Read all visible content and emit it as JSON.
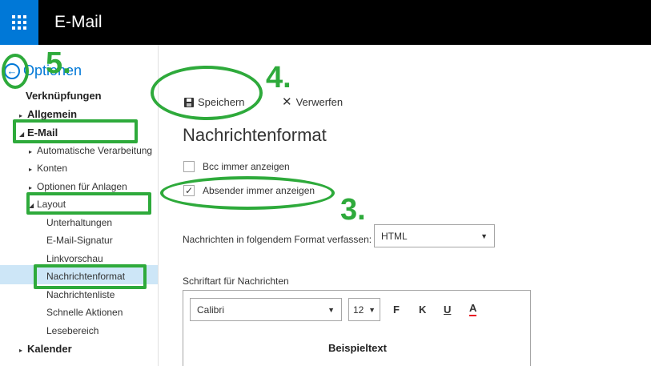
{
  "app": {
    "title": "E-Mail"
  },
  "sidebar": {
    "back_label": "Optionen",
    "items": [
      {
        "label": "Verknüpfungen"
      },
      {
        "label": "Allgemein",
        "arrow": "▸"
      },
      {
        "label": "E-Mail",
        "arrow": "◢"
      },
      {
        "label": "Automatische Verarbeitung",
        "arrow": "▸"
      },
      {
        "label": "Konten",
        "arrow": "▸"
      },
      {
        "label": "Optionen für Anlagen",
        "arrow": "▸"
      },
      {
        "label": "Layout",
        "arrow": "◢"
      },
      {
        "label": "Unterhaltungen"
      },
      {
        "label": "E-Mail-Signatur"
      },
      {
        "label": "Linkvorschau"
      },
      {
        "label": "Nachrichtenformat"
      },
      {
        "label": "Nachrichtenliste"
      },
      {
        "label": "Schnelle Aktionen"
      },
      {
        "label": "Lesebereich"
      },
      {
        "label": "Kalender",
        "arrow": "▸"
      }
    ]
  },
  "toolbar": {
    "save_label": "Speichern",
    "discard_label": "Verwerfen"
  },
  "main": {
    "title": "Nachrichtenformat",
    "bcc_label": "Bcc immer anzeigen",
    "bcc_checked": false,
    "sender_label": "Absender immer anzeigen",
    "sender_checked": true,
    "sender_check_mark": "✓",
    "format_label": "Nachrichten in folgendem Format verfassen:",
    "format_value": "HTML",
    "font_section_label": "Schriftart für Nachrichten",
    "font_name": "Calibri",
    "font_size": "12",
    "bold_label": "F",
    "italic_label": "K",
    "underline_label": "U",
    "color_label": "A",
    "sample_text": "Beispieltext"
  },
  "annotations": {
    "n5": "5.",
    "n4": "4.",
    "n3": "3."
  },
  "colors": {
    "accent": "#0078d7",
    "annotation": "#2eaa3b",
    "selected": "#cde6f7",
    "topbar": "#000000"
  }
}
